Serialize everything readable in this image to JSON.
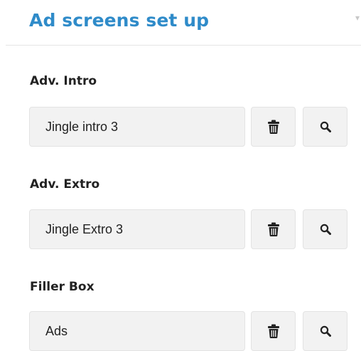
{
  "header": {
    "title": "Ad screens set up"
  },
  "fields": [
    {
      "label": "Adv. Intro",
      "value": "Jingle intro 3"
    },
    {
      "label": "Adv. Extro",
      "value": "Jingle Extro 3"
    },
    {
      "label": "Filler Box",
      "value": "Ads"
    }
  ],
  "icons": {
    "delete": "trash-icon",
    "search": "search-icon"
  },
  "colors": {
    "title": "#2f8bc9",
    "field_background": "#f2f2f2",
    "text": "#222222"
  }
}
